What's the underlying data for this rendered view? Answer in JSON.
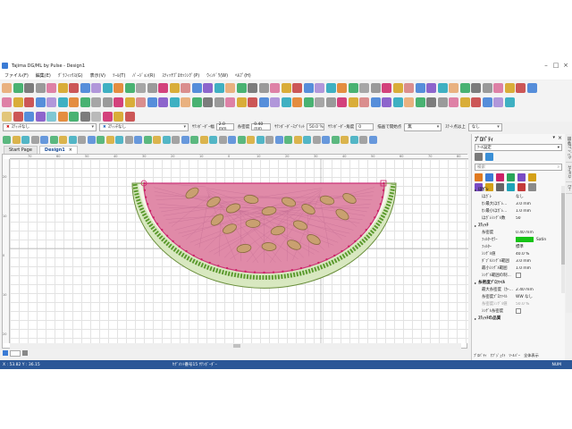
{
  "window": {
    "title": "Tajima DG/ML by Pulse - Design1"
  },
  "menu": [
    "ファイル(F)",
    "編集(E)",
    "ｸﾞﾗﾌｨｯｸｽ(G)",
    "表示(V)",
    "ﾂｰﾙ(T)",
    "ﾊﾞｰｼﾞｮﾝ(R)",
    "ｽﾃｨｯﾁﾌﾟﾛｾｯｼﾝｸﾞ(P)",
    "ｳｨﾝﾄﾞｳ(W)",
    "ﾍﾙﾌﾟ(H)"
  ],
  "propbar": {
    "select1": "ｽﾃｨｯﾁなし",
    "select2": "ｽﾃｨｯﾁなし",
    "width_label": "ｻﾃﾝﾎﾞｰﾀﾞｰ幅",
    "width_value": "2.0 mm",
    "density_label": "糸密度",
    "density_value": "0.40 mm",
    "comp_label": "ｻﾃﾝﾎﾞｰﾀﾞｰｽﾌﾟﾘｯﾄ",
    "comp_value": "50.0 %",
    "angle_label": "ｻﾃﾝﾎﾞｰﾀﾞｰ角度",
    "angle_value": "0",
    "start_label": "描画で開始点",
    "start_value": "無",
    "end_label": "ｽﾃｰﾄ点は上",
    "end_value": "なし"
  },
  "tabs": [
    {
      "label": "Start Page"
    },
    {
      "label": "Design1"
    }
  ],
  "ruler": {
    "h": [
      "70",
      "60",
      "50",
      "40",
      "30",
      "20",
      "10",
      "0",
      "10",
      "20",
      "30",
      "40",
      "50",
      "60",
      "70",
      "80"
    ],
    "v": [
      "20",
      "10",
      "0",
      "10",
      "20"
    ]
  },
  "statusbar": {
    "coords": "X : 53.82 Y : 36.15",
    "message": "ｾｸﾞﾒﾝﾄ番号15 ｻﾃﾝﾎﾞｰﾀﾞｰ",
    "mode": "NUM"
  },
  "properties": {
    "title": "ﾌﾟﾛﾊﾟﾃｨ",
    "combo": "ﾂｰﾙ設定",
    "search_placeholder": "検索",
    "sections": [
      {
        "name": "ほｶﾞﾚ",
        "rows": [
          {
            "k": "ほｶﾞﾚ",
            "v": "なし"
          },
          {
            "k": "ｶﾝ最大ほｶﾞﾚ...",
            "v": "3.0 mm"
          },
          {
            "k": "ｶﾝ最小ほｶﾞﾚ...",
            "v": "1.0 mm"
          },
          {
            "k": "ほｶﾞﾚｼﾝｸﾞﾙ数",
            "v": "50"
          }
        ]
      },
      {
        "name": "ｽﾃｨｯﾁ",
        "rows": [
          {
            "k": "糸密度",
            "v": "0.40 mm"
          },
          {
            "k": "ﾌｨﾙﾀｰｶﾗｰ",
            "v": "Satin",
            "swatch": true
          },
          {
            "k": "ﾌｨﾙﾀｰ",
            "v": "標準"
          },
          {
            "k": "ｼﾝｸﾞﾙ値",
            "v": "40.0 %"
          },
          {
            "k": "ﾀﾞﾌﾞﾙｼﾝｸﾞﾙ範囲",
            "v": "3.0 mm"
          },
          {
            "k": "最小ｼﾝｸﾞﾙ範囲",
            "v": "1.0 mm"
          },
          {
            "k": "ｼﾝｸﾞﾙ範囲の制...",
            "v": "",
            "check": true
          }
        ]
      },
      {
        "name": "糸密度ﾌﾟﾛﾌｧｲﾙ",
        "rows": [
          {
            "k": "最大糸密度（ｶｰ...",
            "v": "2.40 mm"
          },
          {
            "k": "糸密度ﾌﾟﾛﾌｧｲﾙ",
            "v": "WW なし"
          },
          {
            "k": "糸密度ｼﾝｸﾞﾙ値",
            "v": "50.0 %",
            "dis": true
          },
          {
            "k": "ｼﾝｸﾞﾙ糸密度",
            "v": "",
            "check": true
          }
        ]
      },
      {
        "name": "ｽﾃｨｯﾁの品質",
        "rows": []
      }
    ],
    "bottom_tabs": [
      "ﾌﾟﾛﾊﾟﾃｨ",
      "ｵﾌﾞｼﾞｪｸﾄ",
      "ﾂｰﾙﾊﾞｰ",
      "全体表示"
    ]
  },
  "sidetabs": [
    "描画ｵﾌﾞｼﾞｪｸﾄ",
    "ｽﾃｯﾁﾘｽﾄ",
    "ｶﾗｰ"
  ],
  "colors": {
    "status_bg": "#2b5797",
    "melon_flesh": "#e08aa8",
    "seed": "#8a6a40"
  }
}
